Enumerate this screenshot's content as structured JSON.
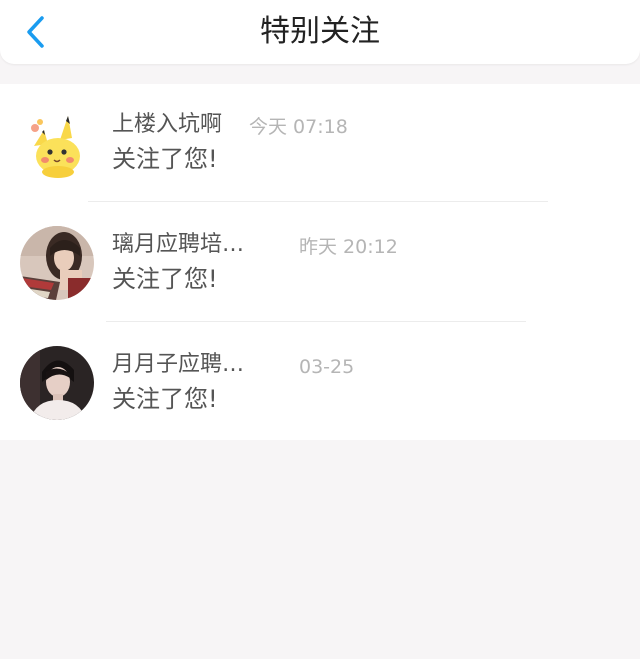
{
  "header": {
    "title": "特别关注",
    "back_icon": "chevron-left-icon",
    "accent_color": "#1a9cf0"
  },
  "items": [
    {
      "name": "上楼入坑啊",
      "time": "今天 07:18",
      "message": "关注了您!",
      "avatar_icon": "pikachu-sticker-avatar"
    },
    {
      "name": "璃月应聘培…",
      "time": "昨天 20:12",
      "message": "关注了您!",
      "avatar_icon": "woman-photo-avatar"
    },
    {
      "name": "月月子应聘…",
      "time": "03-25",
      "message": "关注了您!",
      "avatar_icon": "man-photo-avatar"
    }
  ]
}
